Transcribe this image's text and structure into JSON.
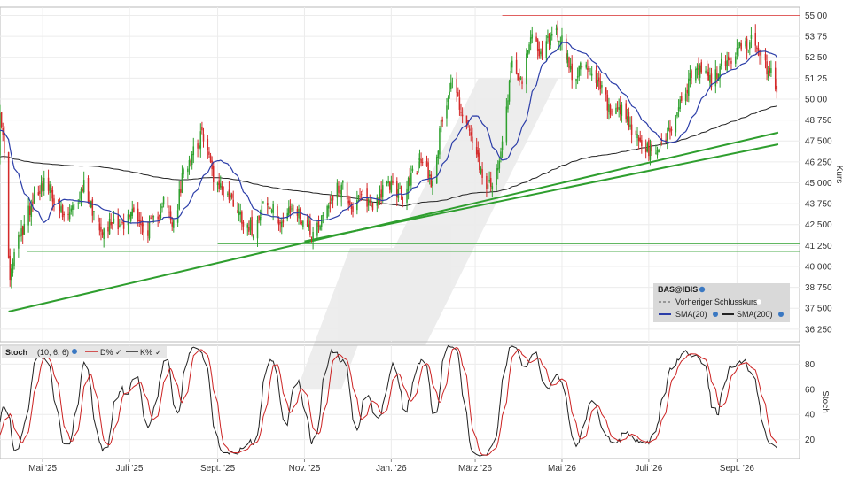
{
  "chart_data": {
    "type": "candlestick",
    "symbol": "BAS@IBIS",
    "price_panel": {
      "ylabel": "Kurs",
      "ylim": [
        35.5,
        55.5
      ],
      "yticks": [
        "55.00",
        "53.75",
        "52.50",
        "51.25",
        "50.00",
        "48.750",
        "47.500",
        "46.250",
        "45.000",
        "43.750",
        "42.500",
        "41.250",
        "40.000",
        "38.750",
        "37.500",
        "36.250"
      ],
      "legend": {
        "title": "BAS@IBIS",
        "items": [
          "Vorheriger Schlusskurs",
          "SMA(20)",
          "SMA(200)"
        ]
      },
      "horizontal_lines": [
        {
          "value": 55.0,
          "color": "#e06060"
        },
        {
          "value": 41.35,
          "color": "#4cae4c"
        },
        {
          "value": 40.9,
          "color": "#4cae4c"
        }
      ],
      "trendlines": [
        {
          "from": [
            "2025-04-07",
            37.3
          ],
          "to": [
            "2026-09-30",
            48.0
          ],
          "color": "#2e9e2e"
        },
        {
          "from": [
            "2025-11-01",
            41.5
          ],
          "to": [
            "2026-09-30",
            47.3
          ],
          "color": "#2e9e2e"
        }
      ],
      "close_path": [
        [
          "2025-04-01",
          49.6
        ],
        [
          "2025-04-04",
          46.5
        ],
        [
          "2025-04-08",
          39.0
        ],
        [
          "2025-04-11",
          40.8
        ],
        [
          "2025-04-17",
          42.2
        ],
        [
          "2025-04-25",
          44.3
        ],
        [
          "2025-05-02",
          45.0
        ],
        [
          "2025-05-09",
          44.1
        ],
        [
          "2025-05-16",
          42.8
        ],
        [
          "2025-05-23",
          43.4
        ],
        [
          "2025-05-30",
          44.9
        ],
        [
          "2025-06-06",
          43.2
        ],
        [
          "2025-06-13",
          42.1
        ],
        [
          "2025-06-20",
          42.9
        ],
        [
          "2025-06-27",
          42.3
        ],
        [
          "2025-07-04",
          43.6
        ],
        [
          "2025-07-11",
          42.0
        ],
        [
          "2025-07-18",
          42.6
        ],
        [
          "2025-07-25",
          44.0
        ],
        [
          "2025-08-01",
          42.3
        ],
        [
          "2025-08-08",
          45.6
        ],
        [
          "2025-08-15",
          47.1
        ],
        [
          "2025-08-22",
          47.9
        ],
        [
          "2025-08-29",
          45.4
        ],
        [
          "2025-09-05",
          44.5
        ],
        [
          "2025-09-12",
          43.9
        ],
        [
          "2025-09-19",
          42.8
        ],
        [
          "2025-09-26",
          42.2
        ],
        [
          "2025-10-03",
          43.8
        ],
        [
          "2025-10-10",
          43.3
        ],
        [
          "2025-10-17",
          42.6
        ],
        [
          "2025-10-24",
          43.5
        ],
        [
          "2025-10-31",
          42.8
        ],
        [
          "2025-11-07",
          42.0
        ],
        [
          "2025-11-14",
          43.1
        ],
        [
          "2025-11-21",
          44.3
        ],
        [
          "2025-11-28",
          44.9
        ],
        [
          "2025-12-05",
          43.4
        ],
        [
          "2025-12-12",
          44.2
        ],
        [
          "2025-12-19",
          43.6
        ],
        [
          "2025-12-26",
          44.5
        ],
        [
          "2026-01-02",
          45.0
        ],
        [
          "2026-01-09",
          44.0
        ],
        [
          "2026-01-16",
          45.6
        ],
        [
          "2026-01-23",
          46.3
        ],
        [
          "2026-01-30",
          45.0
        ],
        [
          "2026-02-06",
          49.0
        ],
        [
          "2026-02-13",
          51.2
        ],
        [
          "2026-02-20",
          49.1
        ],
        [
          "2026-02-27",
          47.5
        ],
        [
          "2026-03-06",
          45.1
        ],
        [
          "2026-03-13",
          44.6
        ],
        [
          "2026-03-20",
          47.6
        ],
        [
          "2026-03-27",
          52.3
        ],
        [
          "2026-04-03",
          51.0
        ],
        [
          "2026-04-10",
          54.0
        ],
        [
          "2026-04-17",
          52.5
        ],
        [
          "2026-04-24",
          54.2
        ],
        [
          "2026-05-01",
          53.6
        ],
        [
          "2026-05-08",
          51.4
        ],
        [
          "2026-05-15",
          52.0
        ],
        [
          "2026-05-22",
          51.2
        ],
        [
          "2026-05-29",
          50.6
        ],
        [
          "2026-06-05",
          48.9
        ],
        [
          "2026-06-12",
          49.2
        ],
        [
          "2026-06-19",
          48.1
        ],
        [
          "2026-06-26",
          47.3
        ],
        [
          "2026-07-03",
          46.6
        ],
        [
          "2026-07-10",
          47.4
        ],
        [
          "2026-07-17",
          48.3
        ],
        [
          "2026-07-24",
          50.0
        ],
        [
          "2026-07-31",
          51.3
        ],
        [
          "2026-08-07",
          51.8
        ],
        [
          "2026-08-14",
          51.0
        ],
        [
          "2026-08-21",
          52.0
        ],
        [
          "2026-08-28",
          52.4
        ],
        [
          "2026-09-04",
          53.1
        ],
        [
          "2026-09-11",
          53.5
        ],
        [
          "2026-09-18",
          52.2
        ],
        [
          "2026-09-25",
          51.6
        ],
        [
          "2026-09-29",
          50.4
        ]
      ],
      "sma20_color": "#2b3da8",
      "sma200_color": "#222222",
      "up_color": "#2ea02e",
      "down_color": "#d42a2a"
    },
    "stoch_panel": {
      "title": "Stoch",
      "params": "(10, 6, 6)",
      "ylabel": "Stoch",
      "ylim": [
        5,
        95
      ],
      "yticks": [
        "80",
        "60",
        "40",
        "20"
      ],
      "series": [
        {
          "name": "D%",
          "color": "#cc2222"
        },
        {
          "name": "K%",
          "color": "#222222"
        }
      ]
    },
    "x_axis": {
      "start": "2025-04-01",
      "end": "2026-10-15",
      "ticks": [
        {
          "date": "2025-05-01",
          "label": "Mai '25"
        },
        {
          "date": "2025-07-01",
          "label": "Juli '25"
        },
        {
          "date": "2025-09-01",
          "label": "Sept. '25"
        },
        {
          "date": "2025-11-01",
          "label": "Nov. '25"
        },
        {
          "date": "2026-01-01",
          "label": "Jan. '26"
        },
        {
          "date": "2026-03-01",
          "label": "März '26"
        },
        {
          "date": "2026-05-01",
          "label": "Mai '26"
        },
        {
          "date": "2026-07-01",
          "label": "Juli '26"
        },
        {
          "date": "2026-09-01",
          "label": "Sept. '26"
        }
      ]
    },
    "grid": true,
    "legend_position": "bottom-right"
  }
}
